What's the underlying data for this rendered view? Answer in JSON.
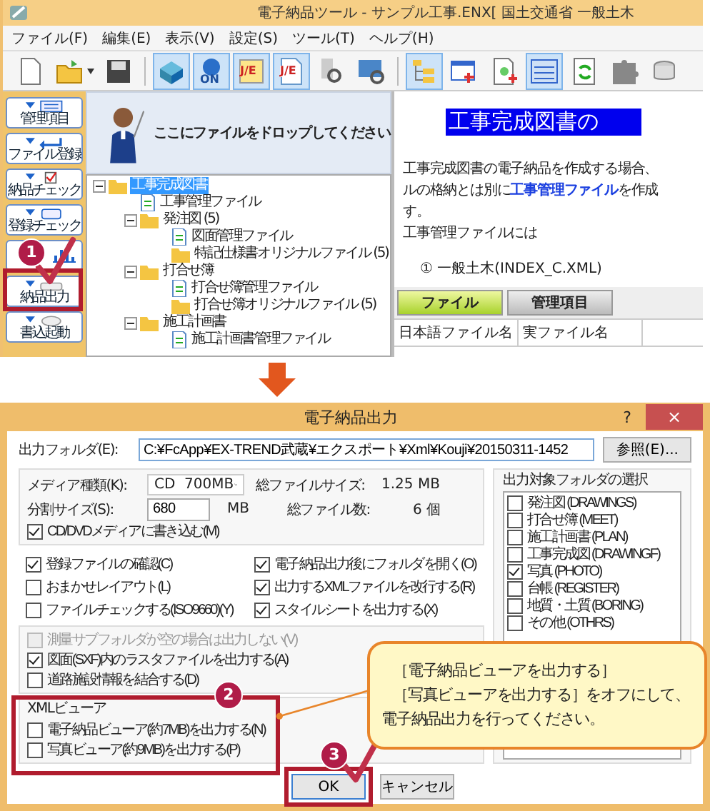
{
  "app_window": {
    "title": "電子納品ツール - サンプル工事.ENX[ 国土交通省 一般土木",
    "menu": [
      "ファイル(F)",
      "編集(E)",
      "表示(V)",
      "設定(S)",
      "ツール(T)",
      "ヘルプ(H)"
    ],
    "toolbar": [
      {
        "kind": "new",
        "selected": false
      },
      {
        "kind": "open",
        "selected": false
      },
      {
        "kind": "save",
        "selected": false
      },
      {
        "kind": "sep"
      },
      {
        "kind": "box",
        "selected": true
      },
      {
        "kind": "badge",
        "label": "ON",
        "selected": true
      },
      {
        "kind": "je",
        "label": "J/E",
        "selected": true
      },
      {
        "kind": "jedoc",
        "label": "J/E",
        "selected": true
      },
      {
        "kind": "scan",
        "selected": false
      },
      {
        "kind": "monitor",
        "selected": false
      },
      {
        "kind": "sep"
      },
      {
        "kind": "tree",
        "selected": true
      },
      {
        "kind": "window",
        "selected": false
      },
      {
        "kind": "docsearch",
        "selected": false
      },
      {
        "kind": "list",
        "selected": true
      },
      {
        "kind": "refresh",
        "selected": false
      },
      {
        "kind": "puzzle",
        "selected": false
      },
      {
        "kind": "disk",
        "selected": false
      }
    ],
    "sidebar": [
      {
        "kind": "form",
        "label": "管理項目"
      },
      {
        "kind": "arrow",
        "label": "ファイル登録"
      },
      {
        "kind": "check",
        "label": "納品チェック"
      },
      {
        "kind": "scan",
        "label": "登録チェック"
      },
      {
        "kind": "chart"
      },
      {
        "kind": "drive",
        "label": "納品出力"
      },
      {
        "kind": "write",
        "label": "書込起動"
      }
    ],
    "drop_hint": "ここにファイルをドロップしてください",
    "tree": [
      {
        "label": "工事完成図書",
        "kind": "folder",
        "expanded": true,
        "selected": true,
        "children": [
          {
            "label": "工事管理ファイル",
            "kind": "file"
          },
          {
            "label": "発注図 (5)",
            "kind": "folder",
            "expanded": true,
            "selected": false,
            "children": [
              {
                "label": "図面管理ファイル",
                "kind": "file"
              },
              {
                "label": "特記仕様書オリジナルファイル (5)",
                "kind": "folder",
                "selected": false
              }
            ]
          },
          {
            "label": "打合せ簿",
            "kind": "folder",
            "expanded": true,
            "selected": false,
            "children": [
              {
                "label": "打合せ簿管理ファイル",
                "kind": "file"
              },
              {
                "label": "打合せ簿オリジナルファイル (5)",
                "kind": "folder",
                "selected": false
              }
            ]
          },
          {
            "label": "施工計画書",
            "kind": "folder",
            "expanded": true,
            "selected": false,
            "children": [
              {
                "label": "施工計画書管理ファイル",
                "kind": "file"
              }
            ]
          }
        ]
      }
    ],
    "help": {
      "heading": "工事完成図書の",
      "lines": [
        "工事完成図書の電子納品を作成する場合、",
        "ルの格納とは別に**工事管理ファイル**を作成",
        "す。",
        "工事管理ファイルには"
      ],
      "item": "①  一般土木(INDEX_C.XML)"
    },
    "tabs": [
      {
        "label": "ファイル",
        "selected": true
      },
      {
        "label": "管理項目",
        "selected": false
      }
    ],
    "columns": [
      "日本語ファイル名",
      "実ファイル名"
    ]
  },
  "dialog": {
    "title": "電子納品出力",
    "help_button": "?",
    "close_button": "×",
    "output_folder": {
      "label": "出力フォルダ(E):",
      "value": "C:¥FcApp¥EX-TREND武蔵¥エクスポート¥Xml¥Kouji¥20150311-1452"
    },
    "browse_button": "参照(E)...",
    "media": {
      "label": "メディア種類(K):",
      "value": "CD  700MB"
    },
    "total_size": {
      "label": "総ファイルサイズ:",
      "value": "1.25 MB"
    },
    "split_size": {
      "label": "分割サイズ(S):",
      "value": "680",
      "unit": "MB"
    },
    "total_files": {
      "label": "総ファイル数:",
      "value": "6 個"
    },
    "write_media": {
      "label": "CD/DVDメディアに書き込む(M)",
      "checked": true
    },
    "options": [
      {
        "label": "登録ファイルの確認(C)",
        "checked": true
      },
      {
        "label": "電子納品出力後にフォルダを開く(O)",
        "checked": true
      },
      {
        "label": "おまかせレイアウト(L)",
        "checked": false
      },
      {
        "label": "出力するXMLファイルを改行する(R)",
        "checked": true
      },
      {
        "label": "ファイルチェックする(ISO9660)(Y)",
        "checked": false
      },
      {
        "label": "スタイルシートを出力する(X)",
        "checked": true
      }
    ],
    "extra_options": [
      {
        "label": "測量サブフォルダが空の場合は出力しない(V)",
        "checked": false,
        "disabled": true
      },
      {
        "label": "図面(SXF)内のラスタファイルを出力する(A)",
        "checked": true,
        "disabled": false
      },
      {
        "label": "道路施設情報を結合する(D)",
        "checked": false,
        "disabled": false
      }
    ],
    "xml_viewer": {
      "title": "XMLビューア",
      "items": [
        {
          "label": "電子納品ビューア(約7MB)を出力する(N)",
          "checked": false
        },
        {
          "label": "写真ビューア(約9MB)を出力する(P)",
          "checked": false
        }
      ]
    },
    "folder_select": {
      "title": "出力対象フォルダの選択",
      "items": [
        {
          "label": "発注図 (DRAWINGS)",
          "checked": false
        },
        {
          "label": "打合せ簿 (MEET)",
          "checked": false
        },
        {
          "label": "施工計画書 (PLAN)",
          "checked": false
        },
        {
          "label": "工事完成図 (DRAWINGF)",
          "checked": false
        },
        {
          "label": "写真 (PHOTO)",
          "checked": true
        },
        {
          "label": "台帳 (REGISTER)",
          "checked": false
        },
        {
          "label": "地質・土質 (BORING)",
          "checked": false
        },
        {
          "label": "その他 (OTHRS)",
          "checked": false
        }
      ]
    },
    "buttons": [
      {
        "label": "OK",
        "default": true
      },
      {
        "label": "キャンセル",
        "default": false
      }
    ]
  },
  "annotations": {
    "steps": [
      "1",
      "2",
      "3"
    ],
    "callout": [
      "［電子納品ビューアを出力する］",
      "［写真ビューアを出力する］をオフにして、",
      "電子納品出力を行ってください。"
    ]
  }
}
